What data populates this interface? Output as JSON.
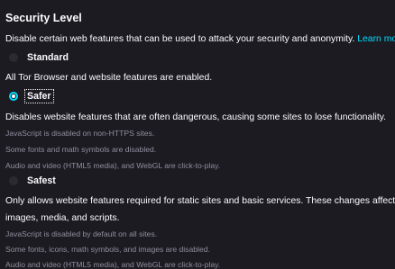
{
  "section": {
    "title": "Security Level",
    "description": "Disable certain web features that can be used to attack your security and anonymity.",
    "learn_more": "Learn more"
  },
  "options": {
    "standard": {
      "label": "Standard",
      "selected": false,
      "summary": "All Tor Browser and website features are enabled."
    },
    "safer": {
      "label": "Safer",
      "selected": true,
      "summary": "Disables website features that are often dangerous, causing some sites to lose functionality.",
      "details": [
        "JavaScript is disabled on non-HTTPS sites.",
        "Some fonts and math symbols are disabled.",
        "Audio and video (HTML5 media), and WebGL are click-to-play."
      ]
    },
    "safest": {
      "label": "Safest",
      "selected": false,
      "summary_line1": "Only allows website features required for static sites and basic services. These changes affect",
      "summary_line2": "images, media, and scripts.",
      "details": [
        "JavaScript is disabled by default on all sites.",
        "Some fonts, icons, math symbols, and images are disabled.",
        "Audio and video (HTML5 media), and WebGL are click-to-play."
      ]
    }
  },
  "colors": {
    "background": "#1c1b22",
    "text": "#fbfbfe",
    "accent": "#00ddff",
    "muted": "#8f8f9d"
  }
}
